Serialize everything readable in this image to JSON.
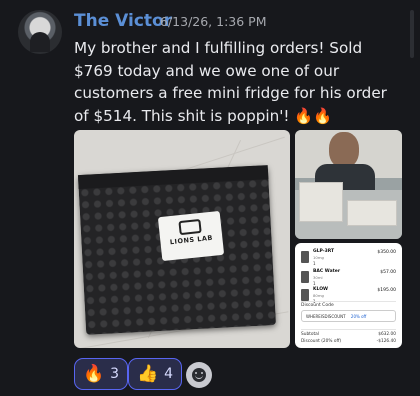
{
  "message": {
    "author": "The Victor",
    "timestamp": "6/13/26, 1:36 PM",
    "text": "My brother and I fulfilling orders! Sold $769 today and we owe one of our customers a free mini fridge for his order of $514.  This shit is poppin'! 🔥🔥"
  },
  "attachments": {
    "mailer_label": "LIONS LAB",
    "receipt": {
      "items": [
        {
          "name": "GLP-3RT",
          "sub": "10mg",
          "qty": "1",
          "price": "$350.00"
        },
        {
          "name": "BAC Water",
          "sub": "30ml",
          "qty": "1",
          "price": "$57.00"
        },
        {
          "name": "KLOW",
          "sub": "80mg",
          "qty": "1",
          "price": "$195.00"
        }
      ],
      "discount_label": "Discount Code",
      "discount_code": "WHEREISDISCOUNT",
      "discount_pct": "20% off",
      "subtotal_label": "Subtotal",
      "subtotal_value": "$632.00",
      "discount_line_label": "Discount (20% off)",
      "discount_line_value": "-$126.40"
    }
  },
  "reactions": [
    {
      "emoji": "🔥",
      "count": "3",
      "icon": "fire-emoji"
    },
    {
      "emoji": "👍",
      "count": "4",
      "icon": "thumbs-up-emoji"
    }
  ],
  "colors": {
    "author": "#5b8fd6",
    "reaction_border": "#5865f2",
    "background": "#17181c"
  }
}
